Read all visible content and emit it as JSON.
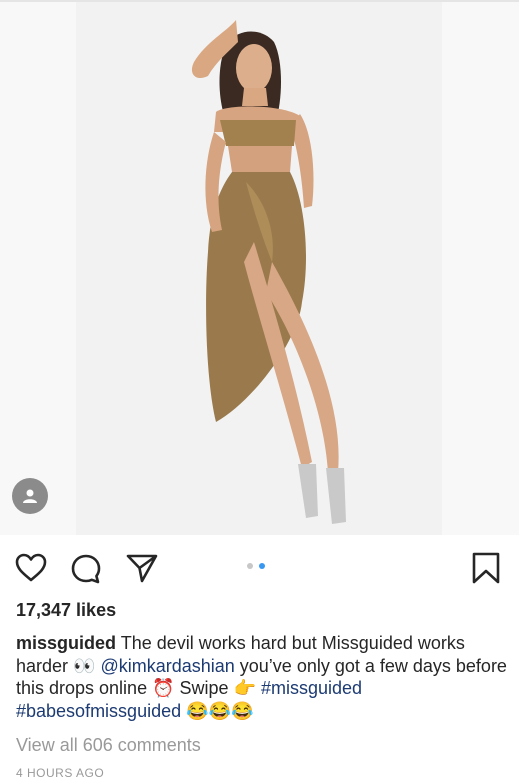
{
  "post": {
    "photo": {
      "description_icon": "model-in-gold-dress-photo",
      "background": "#f1f1f1",
      "dress_color": "#9a7a4c"
    },
    "carousel": {
      "total": 2,
      "active": 2,
      "active_color": "#3897f0",
      "inactive_color": "#c7c7c7"
    },
    "likes": "17,347 likes",
    "caption": {
      "username": "missguided",
      "text_1": " The devil works hard but Missguided works harder 👀 ",
      "mention": "@kimkardashian",
      "text_2": " you’ve only got a few days before this drops online ⏰ Swipe 👉 ",
      "hashtag_1": "#missguided",
      "hashtag_2": "#babesofmissguided",
      "text_3": " 😂😂😂"
    },
    "view_all_comments": "View all 606 comments",
    "timestamp": "4 HOURS AGO"
  },
  "icons": {
    "like": "heart-icon",
    "comment": "comment-icon",
    "share": "paper-plane-icon",
    "save": "bookmark-icon",
    "tag": "person-tag-icon"
  }
}
